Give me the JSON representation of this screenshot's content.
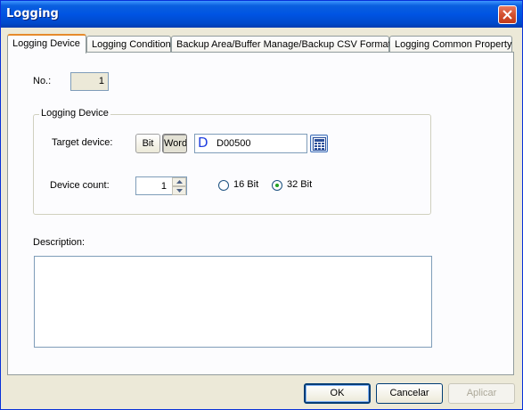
{
  "window": {
    "title": "Logging"
  },
  "tabs": [
    {
      "label": "Logging Device",
      "active": true
    },
    {
      "label": "Logging Condition",
      "active": false
    },
    {
      "label": "Backup Area/Buffer Manage/Backup CSV Format",
      "active": false
    },
    {
      "label": "Logging Common Property",
      "active": false
    }
  ],
  "panel": {
    "number_label": "No.:",
    "number_value": "1",
    "group_title": "Logging Device",
    "target_device_label": "Target device:",
    "bit_button": "Bit",
    "word_button": "Word",
    "device_prefix": "D",
    "device_value": "D00500",
    "device_count_label": "Device count:",
    "device_count_value": "1",
    "radio_16": {
      "label": "16 Bit",
      "checked": false
    },
    "radio_32": {
      "label": "32 Bit",
      "checked": true
    },
    "description_label": "Description:",
    "description_value": ""
  },
  "footer": {
    "ok": "OK",
    "cancel": "Cancelar",
    "apply": "Aplicar"
  },
  "colors": {
    "titlebar": "#0054e3",
    "dialog_bg": "#ece9d8",
    "tab_active_accent": "#e68b2c",
    "device_prefix": "#1f3fe0",
    "radio_checked": "#21a121"
  }
}
